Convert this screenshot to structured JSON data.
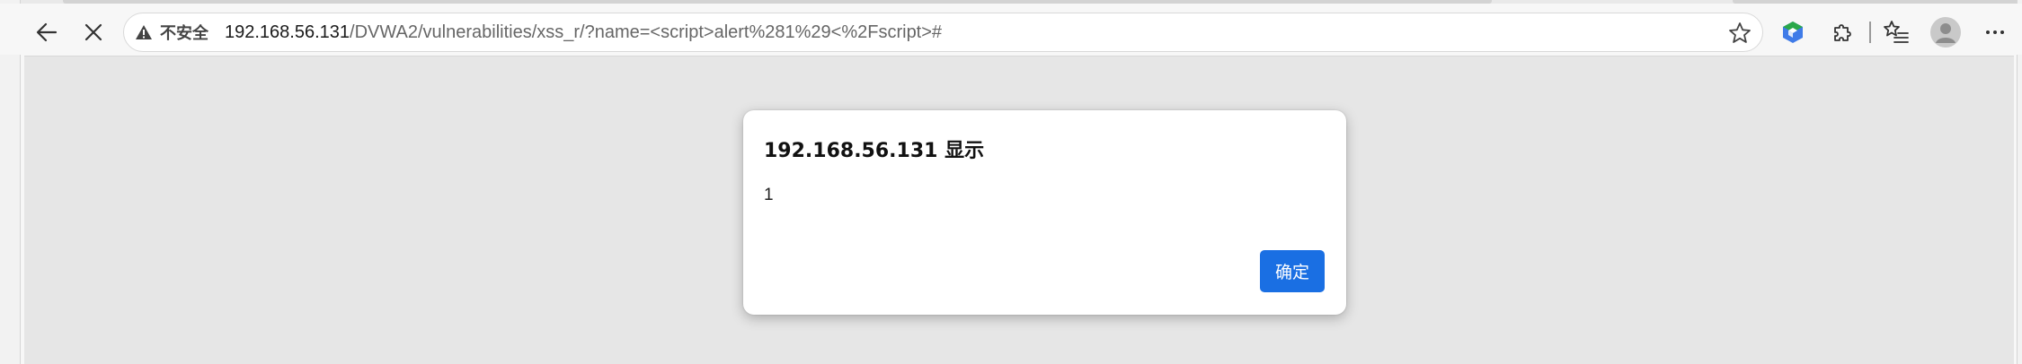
{
  "browser": {
    "security_label": "不安全",
    "url_host": "192.168.56.131",
    "url_path": "/DVWA2/vulnerabilities/xss_r/?name=<script>alert%281%29<%2Fscript>#",
    "icons": {
      "back": "back-arrow-icon",
      "stop": "close-icon",
      "warning": "warning-triangle-icon",
      "favorite": "star-icon",
      "extension": "cube-extension-icon",
      "extensions": "puzzle-icon",
      "favorites": "favorites-list-icon",
      "profile": "avatar-icon",
      "menu": "more-icon"
    }
  },
  "alert_dialog": {
    "title": "192.168.56.131 显示",
    "message": "1",
    "ok_label": "确定"
  },
  "colors": {
    "accent": "#1a6fe3",
    "page_background": "#e6e6e6"
  }
}
